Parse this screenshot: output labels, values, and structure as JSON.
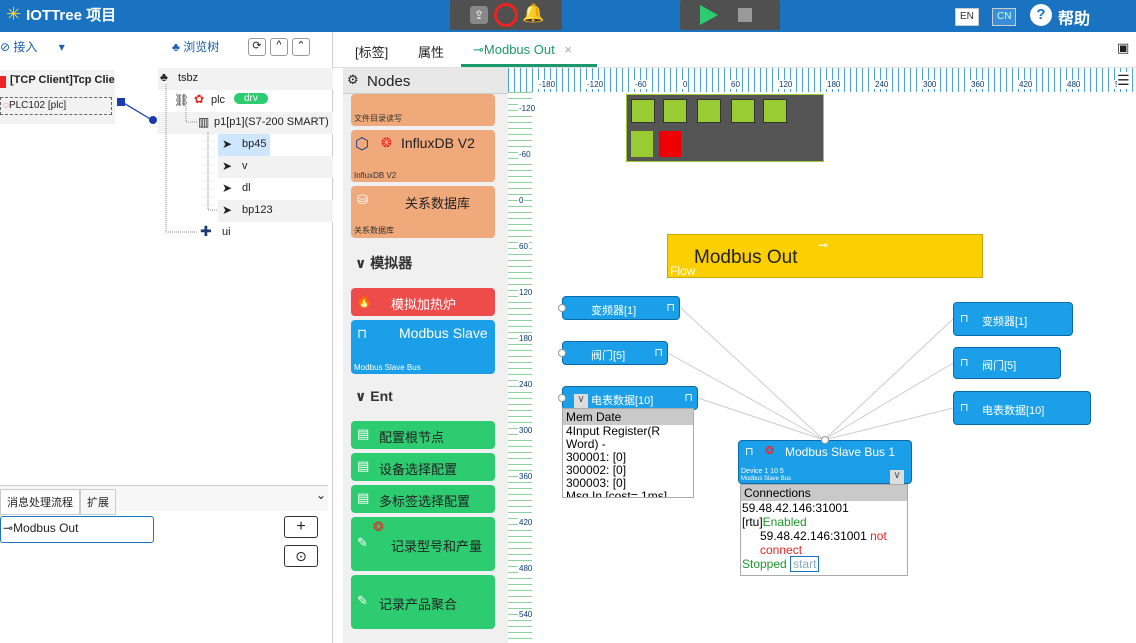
{
  "app": {
    "title": "IOTTree 项目",
    "lang_en": "EN",
    "lang_cn": "CN",
    "help": "帮助"
  },
  "left": {
    "access_label": "接入",
    "browse_label": "浏览树",
    "conn_label": "[TCP Client]Tcp Clie",
    "plc_label": "PLC102 [plc]",
    "tree": {
      "root": "tsbz",
      "plc": "plc",
      "drv_badge": "drv",
      "p1": "p1[p1](S7-200 SMART)",
      "tags": [
        "bp45",
        "v",
        "dl",
        "bp123"
      ],
      "ui": "ui"
    },
    "bottom_tabs": [
      "消息处理流程",
      "扩展"
    ],
    "flow_item": "Modbus Out"
  },
  "tabs": {
    "t1": "[标签]",
    "t2": "属性",
    "t3": "Modbus Out"
  },
  "palette": {
    "title": "Nodes",
    "item_file_sub": "文件目录读写",
    "item_influx": "InfluxDB V2",
    "item_influx_sub": "InfluxDB V2",
    "item_db": "关系数据库",
    "item_db_sub": "关系数据库",
    "sec_sim": "模拟器",
    "item_heat": "模拟加热炉",
    "item_mbslave": "Modbus Slave",
    "item_mbslave_sub": "Modbus Slave Bus",
    "sec_ent": "Ent",
    "item_root": "配置根节点",
    "item_devsel": "设备选择配置",
    "item_multitag": "多标签选择配置",
    "item_record": "记录型号和产量",
    "item_agg": "记录产品聚合"
  },
  "ruler_h": [
    "-180",
    "-120",
    "-60",
    "0",
    "60",
    "120",
    "180",
    "240",
    "300",
    "360",
    "420",
    "480",
    "540"
  ],
  "ruler_v": [
    "-120",
    "-60",
    "0",
    "60",
    "120",
    "180",
    "240",
    "300",
    "360",
    "420",
    "480",
    "540",
    "600"
  ],
  "canvas": {
    "flow_title": "Modbus Out",
    "flow_sub": "Flow",
    "in_nodes": [
      "变频器[1]",
      "阀门[5]",
      "电表数据[10]"
    ],
    "out_nodes": [
      "变频器[1]",
      "阀门[5]",
      "电表数据[10]"
    ],
    "bus_title": "Modbus Slave Bus 1",
    "bus_dev": "Device  1 10 5",
    "bus_sub": "Modbus Slave Bus",
    "mem": {
      "header": "Mem Date",
      "l1": "4Input Register(R",
      "l2": "Word) -",
      "l3": "300001: [0]",
      "l4": "300002: [0]",
      "l5": "300003: [0]",
      "l6": "Msg In [cost= 1ms]"
    },
    "conn": {
      "header": "Connections",
      "addr": "59.48.42.146:31001",
      "rtu": "[rtu]",
      "enabled": "Enabled",
      "addr2": "59.48.42.146:31001",
      "not_connect1": "not",
      "not_connect2": "connect",
      "stopped": "Stopped",
      "start": "start"
    }
  },
  "colors": {
    "topbar": "#1a73c0",
    "node_blue": "#1a9fe8",
    "flow_yellow": "#fcd000",
    "green": "#2ecc71",
    "sim_red": "#ee4b4b",
    "orange": "#f0a97a"
  }
}
